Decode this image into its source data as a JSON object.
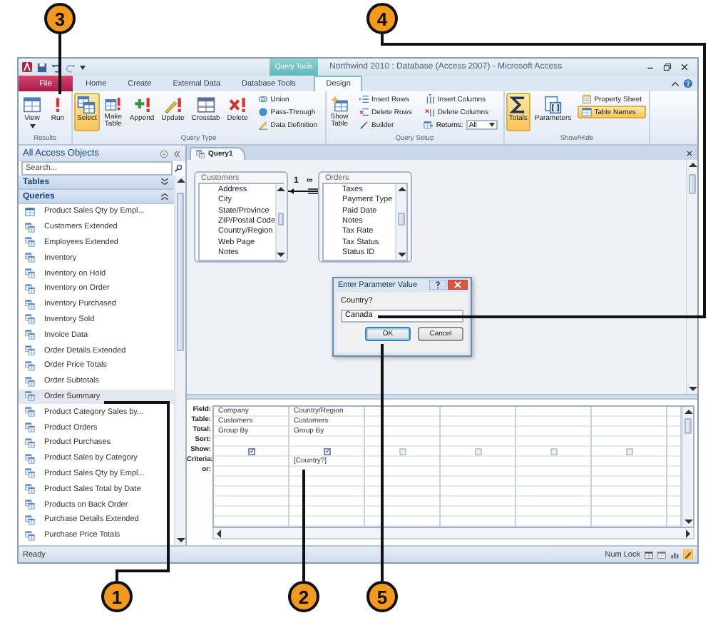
{
  "callouts": [
    {
      "number": "3"
    },
    {
      "number": "4"
    },
    {
      "number": "1"
    },
    {
      "number": "2"
    },
    {
      "number": "5"
    }
  ],
  "window": {
    "title": "Northwind 2010 : Database (Access 2007) - Microsoft Access",
    "context_tab": "Query Tools"
  },
  "ribbon_tabs": [
    {
      "label": "File",
      "kind": "file",
      "selected": false
    },
    {
      "label": "Home",
      "kind": "normal",
      "selected": false
    },
    {
      "label": "Create",
      "kind": "normal",
      "selected": false
    },
    {
      "label": "External Data",
      "kind": "normal",
      "selected": false
    },
    {
      "label": "Database Tools",
      "kind": "normal",
      "selected": false
    },
    {
      "label": "Design",
      "kind": "contextual",
      "selected": true
    }
  ],
  "ribbon_groups": [
    {
      "label": "Results",
      "controls": [
        {
          "label": "View",
          "kind": "large-menu",
          "on": false
        },
        {
          "label": "Run",
          "kind": "large",
          "on": false
        }
      ]
    },
    {
      "label": "Query Type",
      "controls": [
        {
          "label": "Select",
          "kind": "large",
          "on": true
        },
        {
          "label": "Make Table",
          "kind": "large",
          "on": false
        },
        {
          "label": "Append",
          "kind": "large",
          "on": false
        },
        {
          "label": "Update",
          "kind": "large",
          "on": false
        },
        {
          "label": "Crosstab",
          "kind": "large",
          "on": false
        },
        {
          "label": "Delete",
          "kind": "large",
          "on": false
        },
        {
          "label": "Union",
          "kind": "small",
          "on": false
        },
        {
          "label": "Pass-Through",
          "kind": "small",
          "on": false
        },
        {
          "label": "Data Definition",
          "kind": "small",
          "on": false
        }
      ]
    },
    {
      "label": "Query Setup",
      "controls": [
        {
          "label": "Show Table",
          "kind": "large",
          "on": false
        },
        {
          "label": "Insert Rows",
          "kind": "small",
          "on": false
        },
        {
          "label": "Delete Rows",
          "kind": "small",
          "on": false
        },
        {
          "label": "Builder",
          "kind": "small",
          "on": false
        },
        {
          "label": "Insert Columns",
          "kind": "small",
          "on": false
        },
        {
          "label": "Delete Columns",
          "kind": "small",
          "on": false
        },
        {
          "label": "Returns:",
          "kind": "combo",
          "value": "All"
        }
      ]
    },
    {
      "label": "Show/Hide",
      "controls": [
        {
          "label": "Totals",
          "kind": "large",
          "on": true
        },
        {
          "label": "Parameters",
          "kind": "large",
          "on": false
        },
        {
          "label": "Property Sheet",
          "kind": "small",
          "on": false
        },
        {
          "label": "Table Names",
          "kind": "small",
          "on": true
        }
      ]
    }
  ],
  "nav_pane": {
    "title": "All Access Objects",
    "placeholder": "Search...",
    "sections": [
      {
        "label": "Tables",
        "expanded": false
      },
      {
        "label": "Queries",
        "expanded": true,
        "items": [
          {
            "label": "Product Sales Qty by Empl...",
            "kind": "crosstab",
            "selected": false
          },
          {
            "label": "Customers Extended",
            "kind": "select",
            "selected": false
          },
          {
            "label": "Employees Extended",
            "kind": "select",
            "selected": false
          },
          {
            "label": "Inventory",
            "kind": "select",
            "selected": false
          },
          {
            "label": "Inventory on Hold",
            "kind": "select",
            "selected": false
          },
          {
            "label": "Inventory on Order",
            "kind": "select",
            "selected": false
          },
          {
            "label": "Inventory Purchased",
            "kind": "select",
            "selected": false
          },
          {
            "label": "Inventory Sold",
            "kind": "select",
            "selected": false
          },
          {
            "label": "Invoice Data",
            "kind": "select",
            "selected": false
          },
          {
            "label": "Order Details Extended",
            "kind": "select",
            "selected": false
          },
          {
            "label": "Order Price Totals",
            "kind": "select",
            "selected": false
          },
          {
            "label": "Order Subtotals",
            "kind": "select",
            "selected": false
          },
          {
            "label": "Order Summary",
            "kind": "select",
            "selected": true
          },
          {
            "label": "Product Category Sales by...",
            "kind": "select",
            "selected": false
          },
          {
            "label": "Product Orders",
            "kind": "select",
            "selected": false
          },
          {
            "label": "Product Purchases",
            "kind": "select",
            "selected": false
          },
          {
            "label": "Product Sales by Category",
            "kind": "select",
            "selected": false
          },
          {
            "label": "Product Sales Qty by Empl...",
            "kind": "select",
            "selected": false
          },
          {
            "label": "Product Sales Total by Date",
            "kind": "select",
            "selected": false
          },
          {
            "label": "Products on Back Order",
            "kind": "select",
            "selected": false
          },
          {
            "label": "Purchase Details Extended",
            "kind": "select",
            "selected": false
          },
          {
            "label": "Purchase Price Totals",
            "kind": "select",
            "selected": false
          }
        ]
      }
    ]
  },
  "document_tabs": [
    {
      "label": "Query1",
      "selected": true
    }
  ],
  "field_lists": [
    {
      "title": "Customers",
      "fields": [
        "Address",
        "City",
        "State/Province",
        "ZIP/Postal Code",
        "Country/Region",
        "Web Page",
        "Notes"
      ]
    },
    {
      "title": "Orders",
      "fields": [
        "Taxes",
        "Payment Type",
        "Paid Date",
        "Notes",
        "Tax Rate",
        "Tax Status",
        "Status ID"
      ]
    }
  ],
  "relationship": {
    "one_label": "1",
    "many_label": "∞"
  },
  "dialog": {
    "title": "Enter Parameter Value",
    "prompt": "Country?",
    "value": "Canada",
    "buttons": [
      {
        "label": "OK",
        "default": true
      },
      {
        "label": "Cancel",
        "default": false
      }
    ]
  },
  "query_grid": {
    "row_labels": [
      "Field:",
      "Table:",
      "Total:",
      "Sort:",
      "Show:",
      "Criteria:",
      "or:"
    ],
    "columns": [
      {
        "field": "Company",
        "table": "Customers",
        "total": "Group By",
        "show": true
      },
      {
        "field": "Country/Region",
        "table": "Customers",
        "total": "Group By",
        "show": true,
        "criteria": "[Country?]"
      },
      {
        "show": false
      },
      {
        "show": false
      },
      {
        "show": false
      },
      {
        "show": false
      }
    ]
  },
  "status_bar": {
    "text": "Ready",
    "indicator": "Num Lock"
  }
}
